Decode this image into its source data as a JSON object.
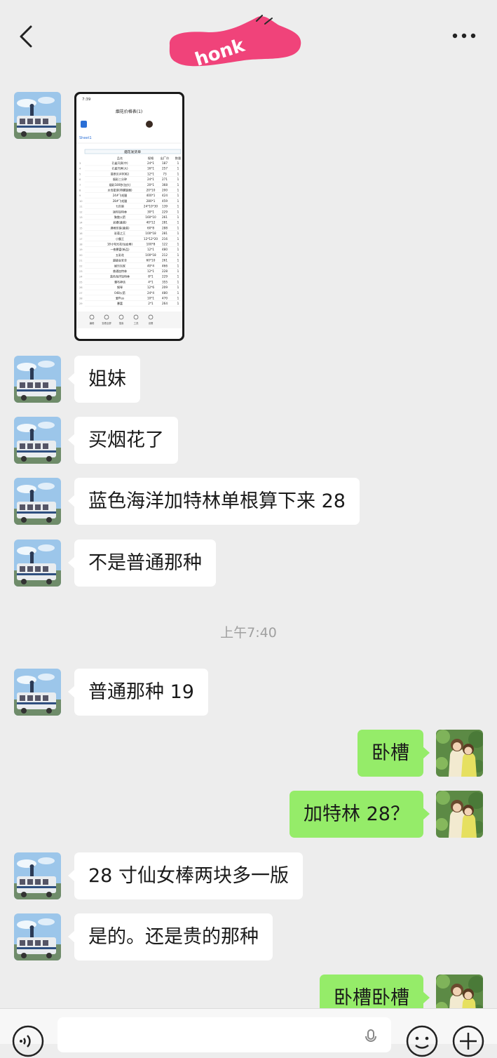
{
  "header": {
    "sticker_text": "honk"
  },
  "shared_screenshot": {
    "status_time": "7:39",
    "doc_title": "烟花价格表(1)",
    "sheet_tab": "Sheet1",
    "table_title": "烟花发货单",
    "columns": [
      "品名",
      "规格",
      "出厂价",
      "数量"
    ],
    "rows": [
      [
        "孔雀开屏(中)",
        "24*1",
        "187",
        "1"
      ],
      [
        "孔雀开屏(大)",
        "16*1",
        "257",
        "1"
      ],
      [
        "翡翠贝(400粒)",
        "12*1",
        "73",
        "1"
      ],
      [
        "烟彩三分钟",
        "24*1",
        "271",
        "1"
      ],
      [
        "烟彩180秒(加大)",
        "20*1",
        "368",
        "1"
      ],
      [
        "水母星球(带螺旋器)",
        "20*10",
        "200",
        "1"
      ],
      [
        "24#飞毛腿",
        "400*1",
        "424",
        "1"
      ],
      [
        "28#飞毛腿",
        "280*1",
        "459",
        "1"
      ],
      [
        "七匹狼",
        "24*10*30",
        "139",
        "1"
      ],
      [
        "迷你加特林",
        "30*1",
        "229",
        "1"
      ],
      [
        "聚散火箭",
        "160*10",
        "261",
        "1"
      ],
      [
        "彩蝶(盒装)",
        "40*12",
        "281",
        "1"
      ],
      [
        "满地珍珠(盒装)",
        "60*8",
        "288",
        "1"
      ],
      [
        "彩菊之王",
        "100*18",
        "281",
        "1"
      ],
      [
        "小霸王",
        "12*12*20",
        "216",
        "1"
      ],
      [
        "18寸电光花(仙女棒)",
        "100*8",
        "122",
        "1"
      ],
      [
        "一夜暴富(新品)",
        "12*1",
        "480",
        "1"
      ],
      [
        "五彩花",
        "100*18",
        "212",
        "1"
      ],
      [
        "超级金安全",
        "60*10",
        "261",
        "1"
      ],
      [
        "娱乐玩家",
        "40*4",
        "466",
        "1"
      ],
      [
        "普通加特林",
        "12*1",
        "228",
        "1"
      ],
      [
        "蓝色海洋加特林",
        "8*1",
        "229",
        "1"
      ],
      [
        "瀑布神话",
        "4*1",
        "355",
        "1"
      ],
      [
        "钢琴",
        "12*6",
        "209",
        "1"
      ],
      [
        "048火箭",
        "24*4",
        "480",
        "1"
      ],
      [
        "爱Plus",
        "10*1",
        "470",
        "1"
      ],
      [
        "暴富",
        "2*1",
        "264",
        "1"
      ]
    ],
    "toolbar": [
      "编辑",
      "查看全屏",
      "搜索",
      "工具",
      "设置"
    ]
  },
  "messages": [
    {
      "side": "in",
      "text": "姐妹"
    },
    {
      "side": "in",
      "text": "买烟花了"
    },
    {
      "side": "in",
      "text": "蓝色海洋加特林单根算下来 28"
    },
    {
      "side": "in",
      "text": "不是普通那种"
    },
    {
      "side": "in",
      "text": "普通那种 19"
    },
    {
      "side": "out",
      "text": "卧槽"
    },
    {
      "side": "out",
      "text": "加特林 28？"
    },
    {
      "side": "in",
      "text": "28 寸仙女棒两块多一版"
    },
    {
      "side": "in",
      "text": "是的。还是贵的那种"
    },
    {
      "side": "out",
      "text": "卧槽卧槽"
    }
  ],
  "timestamp": "上午7:40",
  "icons": {
    "back": "chevron-left-icon",
    "more": "more-dots-icon",
    "voice": "voice-icon",
    "mic": "mic-icon",
    "emoji": "emoji-icon",
    "plus": "plus-icon"
  },
  "colors": {
    "background": "#ededed",
    "incoming_bubble": "#ffffff",
    "outgoing_bubble": "#95ec69",
    "sticker_pink": "#f0437a"
  }
}
